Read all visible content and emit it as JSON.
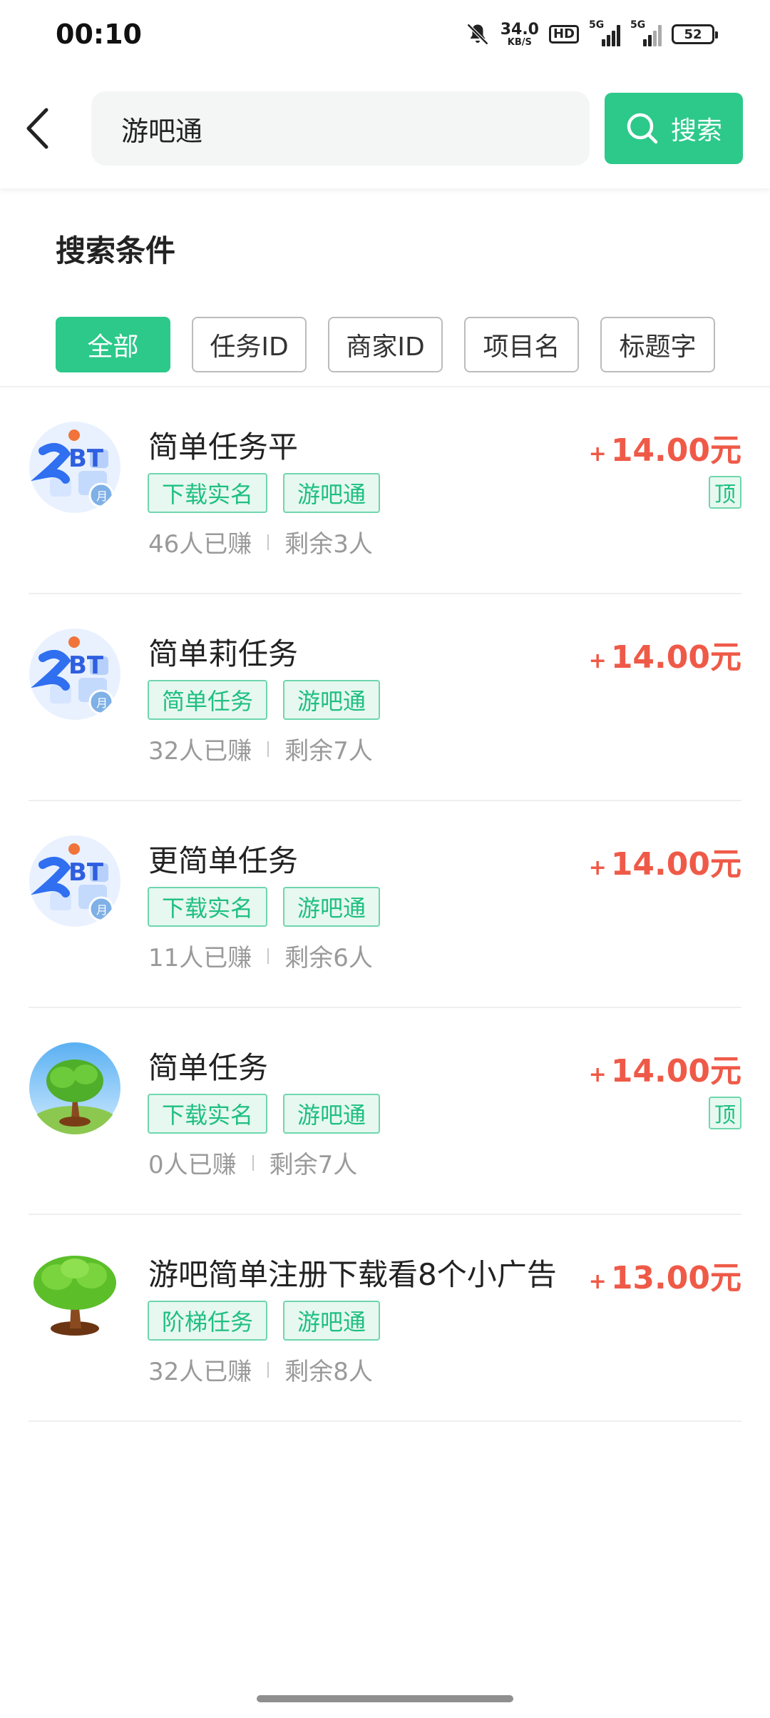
{
  "status_bar": {
    "time": "00:10",
    "net_speed_value": "34.0",
    "net_speed_unit": "KB/S",
    "hd_label": "HD",
    "sim1_label": "5G",
    "sim2_label": "5G",
    "battery": "52"
  },
  "search": {
    "query": "游吧通",
    "button_label": "搜索"
  },
  "criteria": {
    "title": "搜索条件",
    "filters": [
      {
        "label": "全部",
        "active": true
      },
      {
        "label": "任务ID",
        "active": false
      },
      {
        "label": "商家ID",
        "active": false
      },
      {
        "label": "项目名",
        "active": false
      },
      {
        "label": "标题字",
        "active": false
      }
    ]
  },
  "tasks": [
    {
      "avatar": "bt-logo",
      "title": "简单任务平",
      "tags": [
        "下载实名",
        "游吧通"
      ],
      "earned": "46人已赚",
      "remaining": "剩余3人",
      "reward_plus": "+",
      "reward": "14.00元",
      "pinned": true,
      "pin_label": "顶"
    },
    {
      "avatar": "bt-logo",
      "title": "简单莉任务",
      "tags": [
        "简单任务",
        "游吧通"
      ],
      "earned": "32人已赚",
      "remaining": "剩余7人",
      "reward_plus": "+",
      "reward": "14.00元",
      "pinned": false,
      "pin_label": ""
    },
    {
      "avatar": "bt-logo",
      "title": "更简单任务",
      "tags": [
        "下载实名",
        "游吧通"
      ],
      "earned": "11人已赚",
      "remaining": "剩余6人",
      "reward_plus": "+",
      "reward": "14.00元",
      "pinned": false,
      "pin_label": ""
    },
    {
      "avatar": "tree-sky",
      "title": "简单任务",
      "tags": [
        "下载实名",
        "游吧通"
      ],
      "earned": "0人已赚",
      "remaining": "剩余7人",
      "reward_plus": "+",
      "reward": "14.00元",
      "pinned": true,
      "pin_label": "顶"
    },
    {
      "avatar": "tree-white",
      "title": "游吧简单注册下载看8个小广告",
      "tags": [
        "阶梯任务",
        "游吧通"
      ],
      "earned": "32人已赚",
      "remaining": "剩余8人",
      "reward_plus": "+",
      "reward": "13.00元",
      "pinned": false,
      "pin_label": ""
    }
  ],
  "colors": {
    "accent": "#2cc98a",
    "reward": "#ef5a48",
    "tag_text": "#1fbf81",
    "tag_bg": "#e7f8f0"
  }
}
